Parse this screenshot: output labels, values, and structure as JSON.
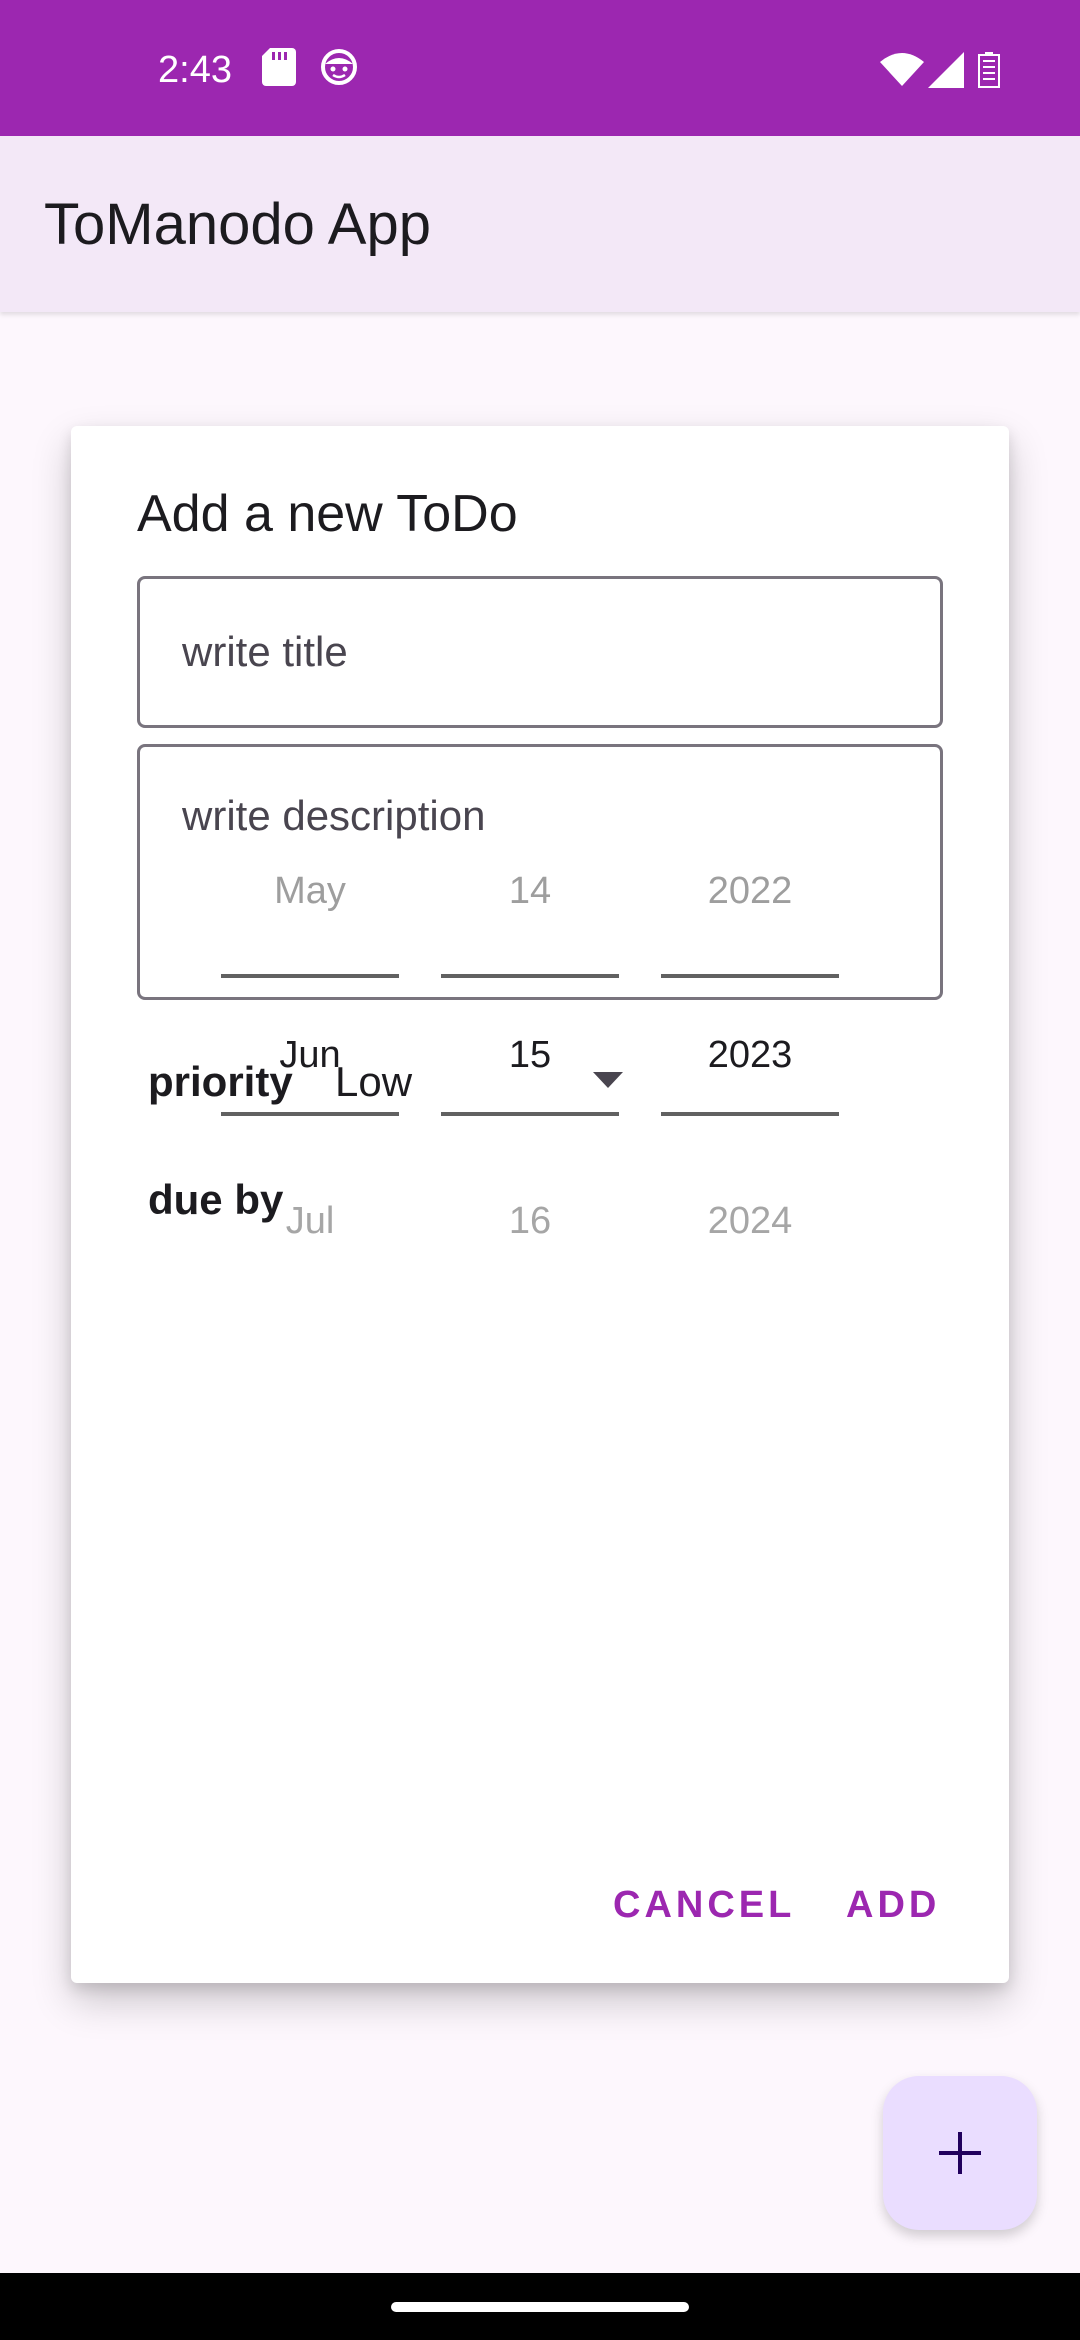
{
  "status_bar": {
    "time": "2:43",
    "icons": [
      "sd-card-icon",
      "face-icon",
      "wifi-icon",
      "signal-icon",
      "battery-icon"
    ]
  },
  "app_bar": {
    "title": "ToManodo App"
  },
  "dialog": {
    "title": "Add a new ToDo",
    "title_field": {
      "placeholder": "write title",
      "value": ""
    },
    "description_field": {
      "placeholder": "write description",
      "value": ""
    },
    "priority": {
      "label": "priority",
      "selected": "Low"
    },
    "due": {
      "label": "due by"
    },
    "date_picker": {
      "month": {
        "prev": "May",
        "current": "Jun",
        "next": "Jul"
      },
      "day": {
        "prev": "14",
        "current": "15",
        "next": "16"
      },
      "year": {
        "prev": "2022",
        "current": "2023",
        "next": "2024"
      }
    },
    "actions": {
      "cancel_label": "CANCEL",
      "add_label": "ADD"
    }
  },
  "fab": {
    "icon": "plus-icon"
  },
  "colors": {
    "primary": "#9c27b0",
    "app_bar_bg": "#f3e8f7",
    "fab_bg": "#eaddff",
    "page_bg": "#fdf7fd"
  }
}
